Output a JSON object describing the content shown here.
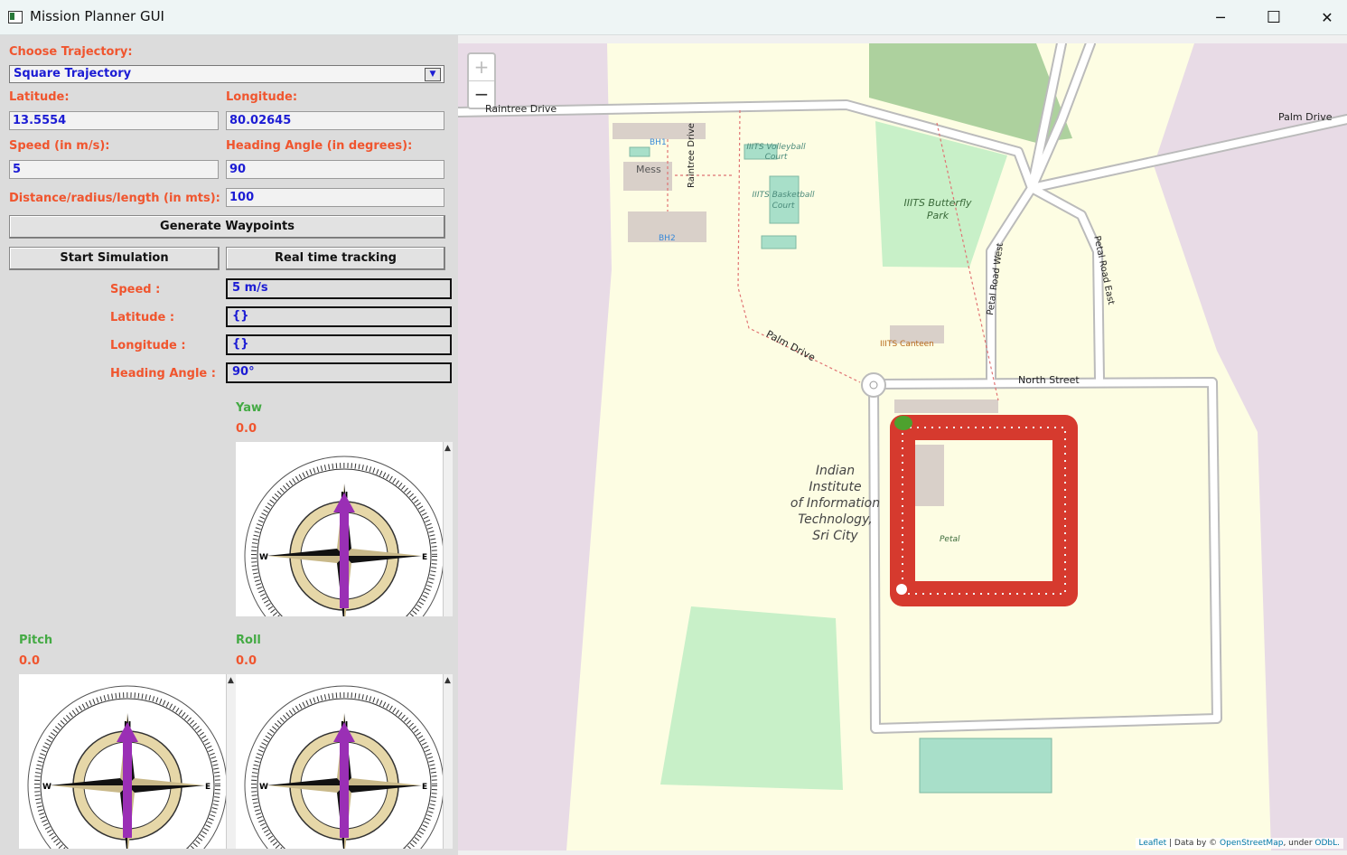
{
  "window": {
    "title": "Mission Planner GUI",
    "minimize": "─",
    "maximize": "☐",
    "close": "✕"
  },
  "controls": {
    "choose_trajectory_label": "Choose Trajectory:",
    "trajectory_value": "Square Trajectory",
    "latitude_label": "Latitude:",
    "latitude_value": "13.5554",
    "longitude_label": "Longitude:",
    "longitude_value": "80.02645",
    "speed_label": "Speed (in m/s):",
    "speed_value": "5",
    "heading_label": "Heading Angle (in degrees):",
    "heading_value": "90",
    "distance_label": "Distance/radius/length (in mts):",
    "distance_value": "100",
    "generate_button": "Generate Waypoints",
    "start_button": "Start Simulation",
    "realtime_button": "Real time tracking"
  },
  "telemetry": {
    "speed_label": "Speed :",
    "speed_value": "5 m/s",
    "latitude_label": "Latitude :",
    "latitude_value": "{}",
    "longitude_label": "Longitude :",
    "longitude_value": "{}",
    "heading_label": "Heading Angle :",
    "heading_value": "90°"
  },
  "attitude": {
    "yaw_label": "Yaw",
    "yaw_value": "0.0",
    "pitch_label": "Pitch",
    "pitch_value": "0.0",
    "roll_label": "Roll",
    "roll_value": "0.0"
  },
  "map": {
    "zoom_in": "+",
    "zoom_out": "−",
    "labels": {
      "raintree_drive_top": "Raintree Drive",
      "palm_drive_top": "Palm Drive",
      "bh1": "BH1",
      "bh2": "BH2",
      "mess": "Mess",
      "volleyball": "IIITS Volleyball Court",
      "basketball": "IIITS Basketball Court",
      "butterfly_park": "IIITS Butterfly Park",
      "raintree_drive_vertical": "Raintree Drive",
      "petal_road_west": "Petal Road West",
      "petal_road_east": "Petal Road East",
      "palm_drive_diag": "Palm Drive",
      "canteen": "IIITS Canteen",
      "north_street": "North Street",
      "institute_line1": "Indian",
      "institute_line2": "Institute",
      "institute_line3": "of Information",
      "institute_line4": "Technology,",
      "institute_line5": "Sri City",
      "petal": "Petal"
    },
    "attribution": {
      "leaflet": "Leaflet",
      "mid": " | Data by © ",
      "osm": "OpenStreetMap",
      "under": ", under ",
      "odbl": "ODbL."
    },
    "colors": {
      "land": "#fdfde3",
      "residential": "#e8dbe6",
      "park": "#c8f0c8",
      "building": "#d9d0c9",
      "marker": "#d63a2e"
    }
  }
}
